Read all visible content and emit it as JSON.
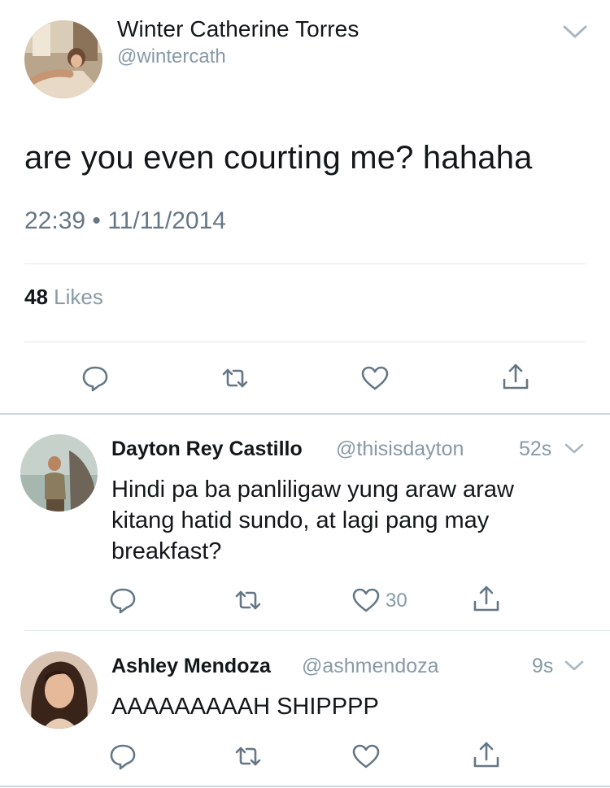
{
  "tweet": {
    "author_name": "Winter Catherine Torres",
    "author_handle": "@wintercath",
    "text": "are you even courting me? hahaha",
    "timestamp": "22:39 • 11/11/2014",
    "likes_count": "48",
    "likes_label": "Likes"
  },
  "replies": [
    {
      "name": "Dayton Rey Castillo",
      "handle": "@thisisdayton",
      "time": "52s",
      "text": "Hindi pa ba panliligaw yung araw araw kitang hatid sundo, at lagi pang may breakfast?",
      "like_count": "30"
    },
    {
      "name": "Ashley Mendoza",
      "handle": "@ashmendoza",
      "time": "9s",
      "text": "AAAAAAAAAH SHIPPPP"
    }
  ],
  "colors": {
    "text_primary": "#14171a",
    "text_secondary": "#657786",
    "icon_gray": "#657786",
    "divider": "#e1e8ed"
  },
  "icons": [
    "reply-icon",
    "retweet-icon",
    "heart-icon",
    "share-icon",
    "chevron-down-icon"
  ]
}
